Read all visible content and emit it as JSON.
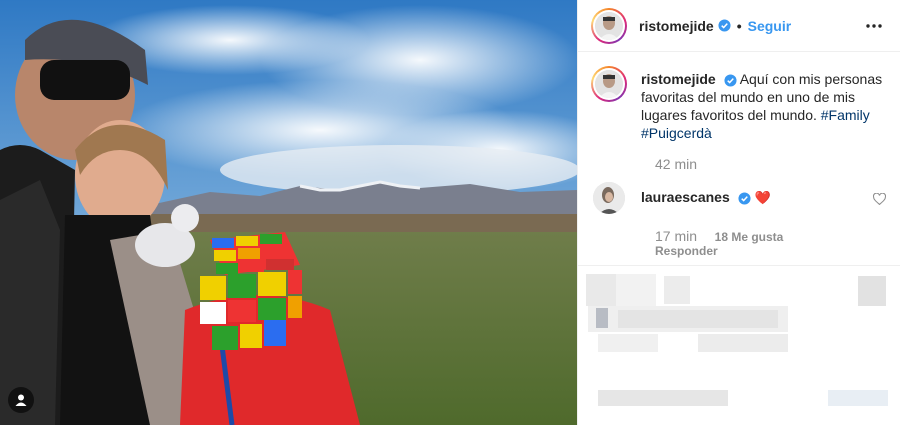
{
  "post": {
    "username": "ristomejide",
    "follow_label": "Seguir",
    "separator": "•",
    "caption_text": "Aquí con mis personas favoritas del mundo en uno de mis lugares favoritos del mundo.",
    "hashtags": [
      "#Family",
      "#Puigcerdà"
    ],
    "caption_time": "42 min"
  },
  "comment": {
    "username": "lauraescanes",
    "emoji": "❤️",
    "time": "17 min",
    "likes": "18 Me gusta",
    "reply_label": "Responder"
  },
  "colors": {
    "accent": "#3897f0",
    "verified": "#3897f0",
    "hashtag": "#003569",
    "heart": "#ed4956",
    "muted": "#8e8e8e"
  },
  "icons": [
    "verified-badge-icon",
    "more-options-icon",
    "heart-icon",
    "user-tag-icon"
  ]
}
